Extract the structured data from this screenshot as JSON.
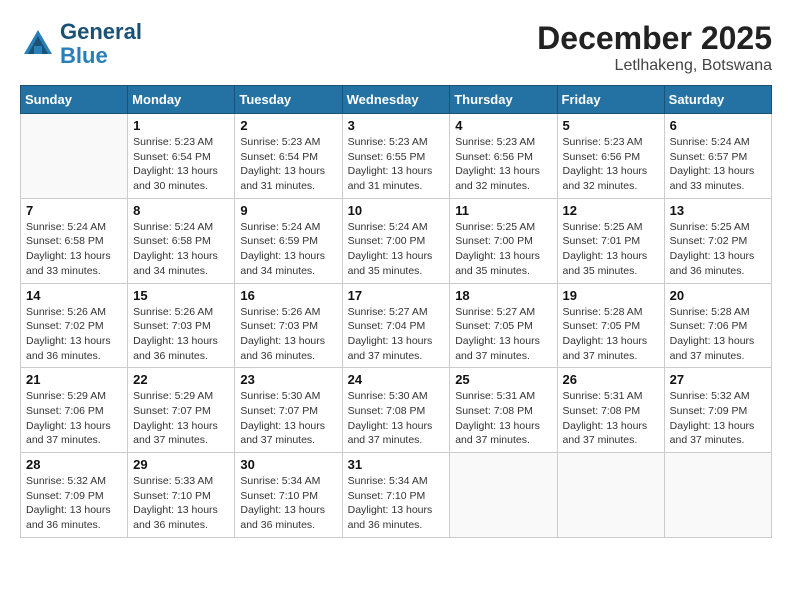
{
  "logo": {
    "line1": "General",
    "line2": "Blue"
  },
  "title": "December 2025",
  "location": "Letlhakeng, Botswana",
  "days_of_week": [
    "Sunday",
    "Monday",
    "Tuesday",
    "Wednesday",
    "Thursday",
    "Friday",
    "Saturday"
  ],
  "weeks": [
    [
      {
        "day": "",
        "info": ""
      },
      {
        "day": "1",
        "info": "Sunrise: 5:23 AM\nSunset: 6:54 PM\nDaylight: 13 hours\nand 30 minutes."
      },
      {
        "day": "2",
        "info": "Sunrise: 5:23 AM\nSunset: 6:54 PM\nDaylight: 13 hours\nand 31 minutes."
      },
      {
        "day": "3",
        "info": "Sunrise: 5:23 AM\nSunset: 6:55 PM\nDaylight: 13 hours\nand 31 minutes."
      },
      {
        "day": "4",
        "info": "Sunrise: 5:23 AM\nSunset: 6:56 PM\nDaylight: 13 hours\nand 32 minutes."
      },
      {
        "day": "5",
        "info": "Sunrise: 5:23 AM\nSunset: 6:56 PM\nDaylight: 13 hours\nand 32 minutes."
      },
      {
        "day": "6",
        "info": "Sunrise: 5:24 AM\nSunset: 6:57 PM\nDaylight: 13 hours\nand 33 minutes."
      }
    ],
    [
      {
        "day": "7",
        "info": "Sunrise: 5:24 AM\nSunset: 6:58 PM\nDaylight: 13 hours\nand 33 minutes."
      },
      {
        "day": "8",
        "info": "Sunrise: 5:24 AM\nSunset: 6:58 PM\nDaylight: 13 hours\nand 34 minutes."
      },
      {
        "day": "9",
        "info": "Sunrise: 5:24 AM\nSunset: 6:59 PM\nDaylight: 13 hours\nand 34 minutes."
      },
      {
        "day": "10",
        "info": "Sunrise: 5:24 AM\nSunset: 7:00 PM\nDaylight: 13 hours\nand 35 minutes."
      },
      {
        "day": "11",
        "info": "Sunrise: 5:25 AM\nSunset: 7:00 PM\nDaylight: 13 hours\nand 35 minutes."
      },
      {
        "day": "12",
        "info": "Sunrise: 5:25 AM\nSunset: 7:01 PM\nDaylight: 13 hours\nand 35 minutes."
      },
      {
        "day": "13",
        "info": "Sunrise: 5:25 AM\nSunset: 7:02 PM\nDaylight: 13 hours\nand 36 minutes."
      }
    ],
    [
      {
        "day": "14",
        "info": "Sunrise: 5:26 AM\nSunset: 7:02 PM\nDaylight: 13 hours\nand 36 minutes."
      },
      {
        "day": "15",
        "info": "Sunrise: 5:26 AM\nSunset: 7:03 PM\nDaylight: 13 hours\nand 36 minutes."
      },
      {
        "day": "16",
        "info": "Sunrise: 5:26 AM\nSunset: 7:03 PM\nDaylight: 13 hours\nand 36 minutes."
      },
      {
        "day": "17",
        "info": "Sunrise: 5:27 AM\nSunset: 7:04 PM\nDaylight: 13 hours\nand 37 minutes."
      },
      {
        "day": "18",
        "info": "Sunrise: 5:27 AM\nSunset: 7:05 PM\nDaylight: 13 hours\nand 37 minutes."
      },
      {
        "day": "19",
        "info": "Sunrise: 5:28 AM\nSunset: 7:05 PM\nDaylight: 13 hours\nand 37 minutes."
      },
      {
        "day": "20",
        "info": "Sunrise: 5:28 AM\nSunset: 7:06 PM\nDaylight: 13 hours\nand 37 minutes."
      }
    ],
    [
      {
        "day": "21",
        "info": "Sunrise: 5:29 AM\nSunset: 7:06 PM\nDaylight: 13 hours\nand 37 minutes."
      },
      {
        "day": "22",
        "info": "Sunrise: 5:29 AM\nSunset: 7:07 PM\nDaylight: 13 hours\nand 37 minutes."
      },
      {
        "day": "23",
        "info": "Sunrise: 5:30 AM\nSunset: 7:07 PM\nDaylight: 13 hours\nand 37 minutes."
      },
      {
        "day": "24",
        "info": "Sunrise: 5:30 AM\nSunset: 7:08 PM\nDaylight: 13 hours\nand 37 minutes."
      },
      {
        "day": "25",
        "info": "Sunrise: 5:31 AM\nSunset: 7:08 PM\nDaylight: 13 hours\nand 37 minutes."
      },
      {
        "day": "26",
        "info": "Sunrise: 5:31 AM\nSunset: 7:08 PM\nDaylight: 13 hours\nand 37 minutes."
      },
      {
        "day": "27",
        "info": "Sunrise: 5:32 AM\nSunset: 7:09 PM\nDaylight: 13 hours\nand 37 minutes."
      }
    ],
    [
      {
        "day": "28",
        "info": "Sunrise: 5:32 AM\nSunset: 7:09 PM\nDaylight: 13 hours\nand 36 minutes."
      },
      {
        "day": "29",
        "info": "Sunrise: 5:33 AM\nSunset: 7:10 PM\nDaylight: 13 hours\nand 36 minutes."
      },
      {
        "day": "30",
        "info": "Sunrise: 5:34 AM\nSunset: 7:10 PM\nDaylight: 13 hours\nand 36 minutes."
      },
      {
        "day": "31",
        "info": "Sunrise: 5:34 AM\nSunset: 7:10 PM\nDaylight: 13 hours\nand 36 minutes."
      },
      {
        "day": "",
        "info": ""
      },
      {
        "day": "",
        "info": ""
      },
      {
        "day": "",
        "info": ""
      }
    ]
  ]
}
